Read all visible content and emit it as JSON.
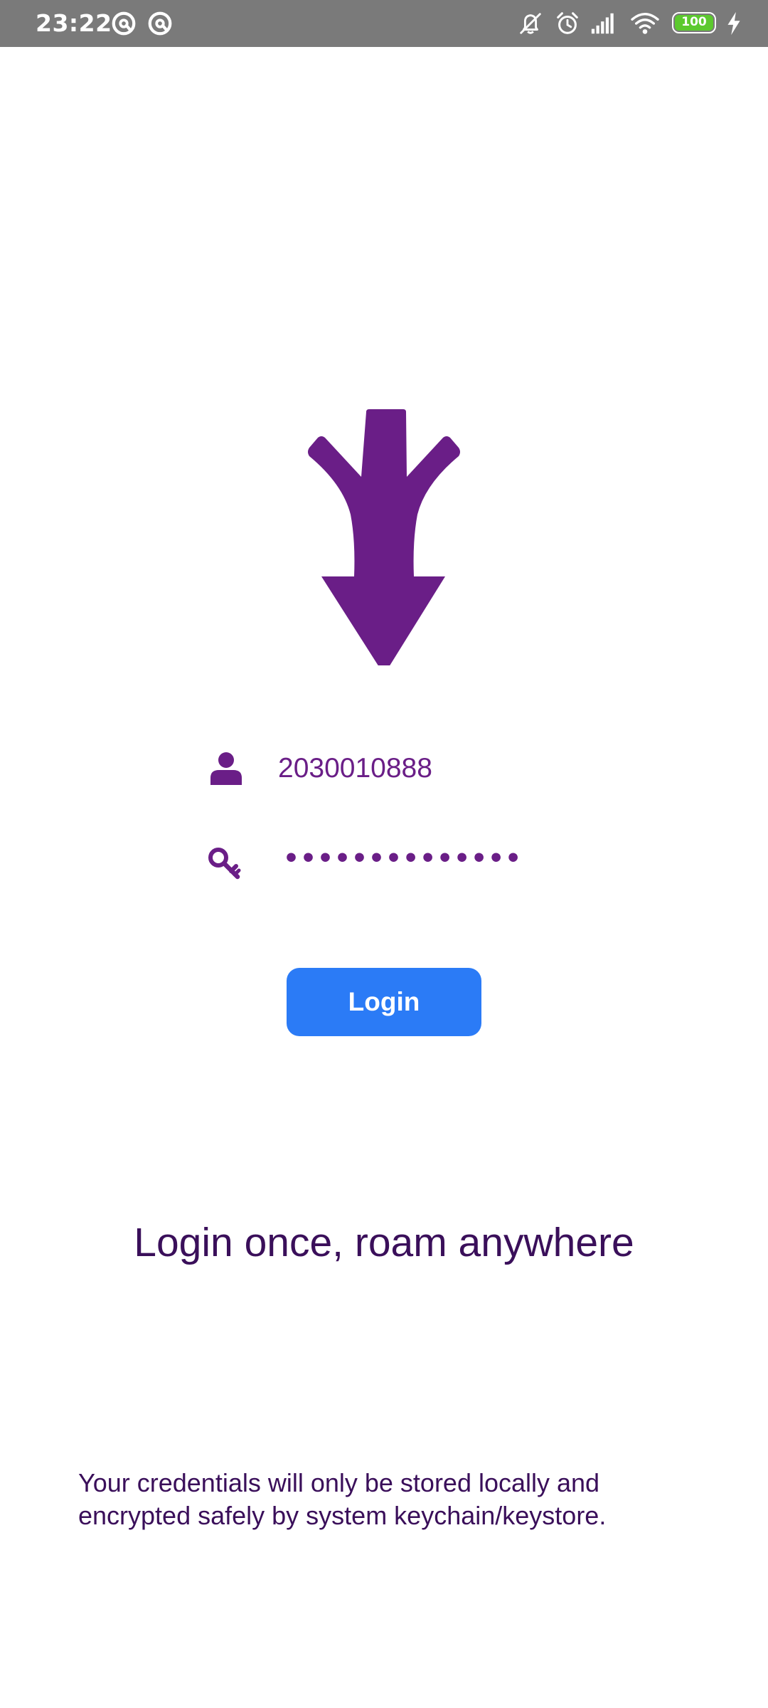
{
  "status_bar": {
    "time": "23:22",
    "battery_level": "100",
    "icons": [
      "notification-app-icon",
      "notification-app-icon",
      "mute-icon",
      "alarm-icon",
      "signal-icon",
      "wifi-icon",
      "battery-icon",
      "charging-icon"
    ]
  },
  "logo": {
    "icon": "arrow-logo-icon",
    "color": "#6a1e87"
  },
  "form": {
    "username": {
      "icon": "person-icon",
      "value": "2030010888"
    },
    "password": {
      "icon": "key-icon",
      "value": "••••••••••••••"
    },
    "login_label": "Login"
  },
  "tagline": "Login once, roam anywhere",
  "disclaimer": {
    "line1": "Your credentials will only be stored locally and",
    "line2": "encrypted safely by system keychain/keystore."
  },
  "colors": {
    "brand_purple": "#6a1e87",
    "text_dark_purple": "#3a0f5a",
    "button_blue": "#2b7bf6",
    "status_bar": "#7a7a7a",
    "battery_green": "#5cc92e"
  }
}
